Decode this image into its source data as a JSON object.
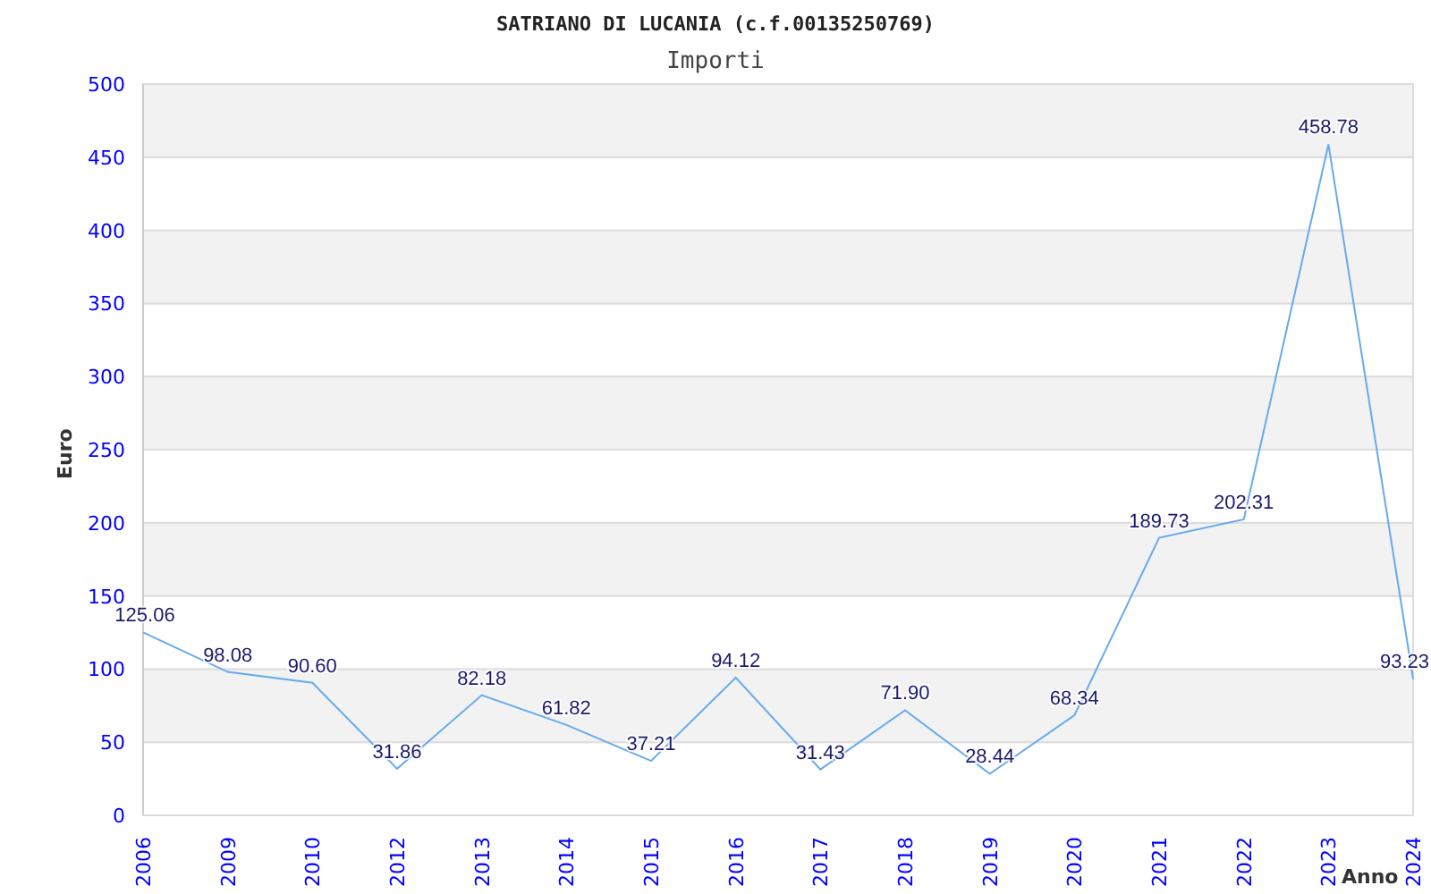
{
  "chart_data": {
    "type": "line",
    "title": "SATRIANO DI LUCANIA (c.f.00135250769)",
    "xlabel": "Anno",
    "ylabel": "Euro",
    "categories": [
      "2006",
      "2009",
      "2010",
      "2012",
      "2013",
      "2014",
      "2015",
      "2016",
      "2017",
      "2018",
      "2019",
      "2020",
      "2021",
      "2022",
      "2023",
      "2024"
    ],
    "series": [
      {
        "name": "Importi",
        "color": "#66aaee",
        "values": [
          125.06,
          98.08,
          90.6,
          31.86,
          82.18,
          61.82,
          37.21,
          94.12,
          31.43,
          71.9,
          28.44,
          68.34,
          189.73,
          202.31,
          458.78,
          93.23
        ]
      }
    ],
    "value_labels": [
      "125.06",
      "98.08",
      "90.60",
      "31.86",
      "82.18",
      "61.82",
      "37.21",
      "94.12",
      "31.43",
      "71.90",
      "28.44",
      "68.34",
      "189.73",
      "202.31",
      "458.78",
      "93.23"
    ],
    "ylim": [
      0,
      500
    ],
    "yticks": [
      0,
      50,
      100,
      150,
      200,
      250,
      300,
      350,
      400,
      450,
      500
    ]
  }
}
